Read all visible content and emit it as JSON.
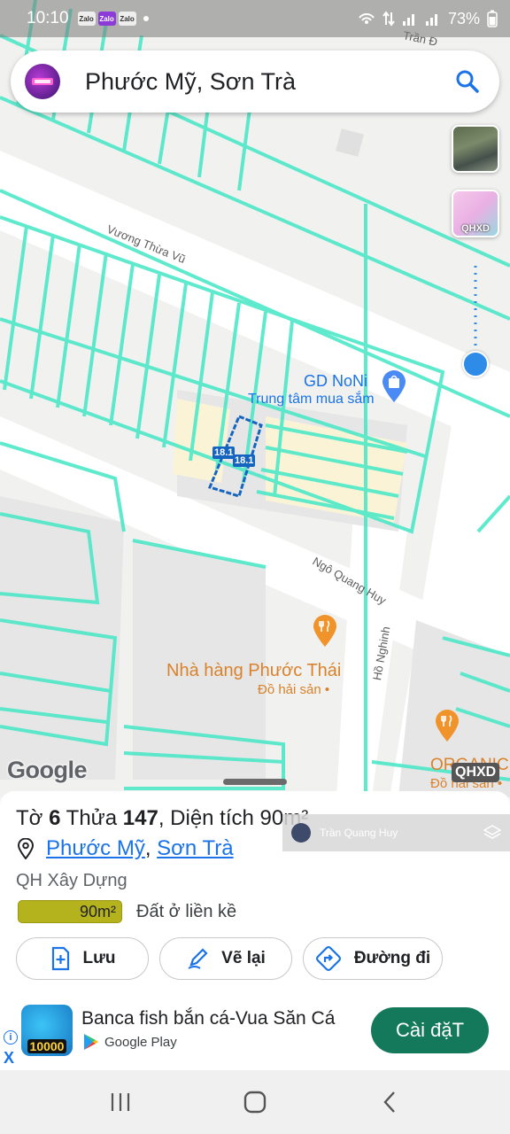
{
  "status_bar": {
    "time": "10:10",
    "app_icons": [
      "Zalo",
      "Zalo",
      "Zalo"
    ],
    "battery": "73%"
  },
  "search": {
    "query": "Phước Mỹ, Sơn Trà"
  },
  "layers": {
    "planning_label": "QHXD"
  },
  "map": {
    "street_top_partial": "Trần Đ",
    "street_1": "Vương Thừa Vũ",
    "street_2": "Ngô Quang Huy",
    "street_3": "Hồ Nghinh",
    "poi_1_name": "GD NoNi",
    "poi_1_sub": "Trung tâm mua sắm",
    "poi_2_name": "Nhà hàng Phước Thái",
    "poi_2_sub": "Đồ hải sản •",
    "poi_3_name": "ORGANIC",
    "poi_3_sub": "Đồ hải sản •",
    "parcel_tag_1": "18.1",
    "parcel_tag_2": "18.1",
    "google_logo": "Google",
    "qhxd_badge": "QHXD",
    "accent_colors": {
      "parcel_line": "#4ee8c8",
      "selected_parcel": "#1565c0"
    }
  },
  "parcel": {
    "title_prefix": "Tờ ",
    "sheet_no": "6",
    "title_mid": " Thửa ",
    "plot_no": "147",
    "title_area_prefix": ", Diện tích ",
    "area": "90m²",
    "ward": "Phước Mỹ",
    "separator": ",",
    "district": "Sơn Trà",
    "planning_type": "QH Xây Dựng",
    "area_badge": "90m²",
    "land_use": "Đất ở liền kề"
  },
  "watermark": {
    "name": "Trần Quang Huy"
  },
  "actions": {
    "save_label": "Lưu",
    "redraw_label": "Vẽ lại",
    "route_label": "Đường đi"
  },
  "ad": {
    "icon_text": "10000",
    "title": "Banca fish bắn cá-Vua Săn Cá",
    "store": "Google Play",
    "install_label": "Cài đặT",
    "info_label": "i",
    "close_label": "X"
  }
}
